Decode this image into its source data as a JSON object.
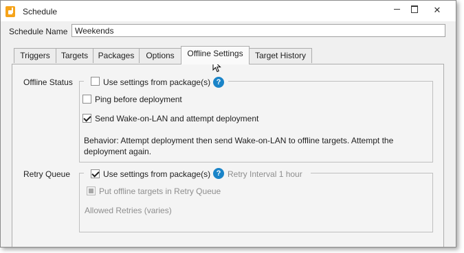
{
  "window": {
    "title": "Schedule",
    "controls": {
      "minimize": "—",
      "maximize": "☐",
      "close": "✕"
    }
  },
  "schedule_name": {
    "label": "Schedule Name",
    "value": "Weekends"
  },
  "tabs": [
    {
      "label": "Triggers",
      "active": false
    },
    {
      "label": "Targets",
      "active": false
    },
    {
      "label": "Packages",
      "active": false
    },
    {
      "label": "Options",
      "active": false
    },
    {
      "label": "Offline Settings",
      "active": true
    },
    {
      "label": "Target History",
      "active": false
    }
  ],
  "offline_status": {
    "section_label": "Offline Status",
    "use_settings": {
      "label": "Use settings from package(s)",
      "checked": false
    },
    "help": "?",
    "ping": {
      "label": "Ping before deployment",
      "checked": false
    },
    "wol": {
      "label": "Send Wake-on-LAN and attempt deployment",
      "checked": true
    },
    "behavior": "Behavior: Attempt deployment then send Wake-on-LAN to offline targets. Attempt the deployment again."
  },
  "retry_queue": {
    "section_label": "Retry Queue",
    "use_settings": {
      "label": "Use settings from package(s)",
      "checked": true
    },
    "help": "?",
    "retry_interval": "Retry Interval  1 hour",
    "put_offline": {
      "label": "Put offline targets in Retry Queue",
      "state": "indeterminate"
    },
    "allowed_retries": "Allowed Retries  (varies)"
  },
  "colors": {
    "accent": "#f5a31a",
    "help_blue": "#1a84c8",
    "disabled_text": "#8e8e8e"
  }
}
